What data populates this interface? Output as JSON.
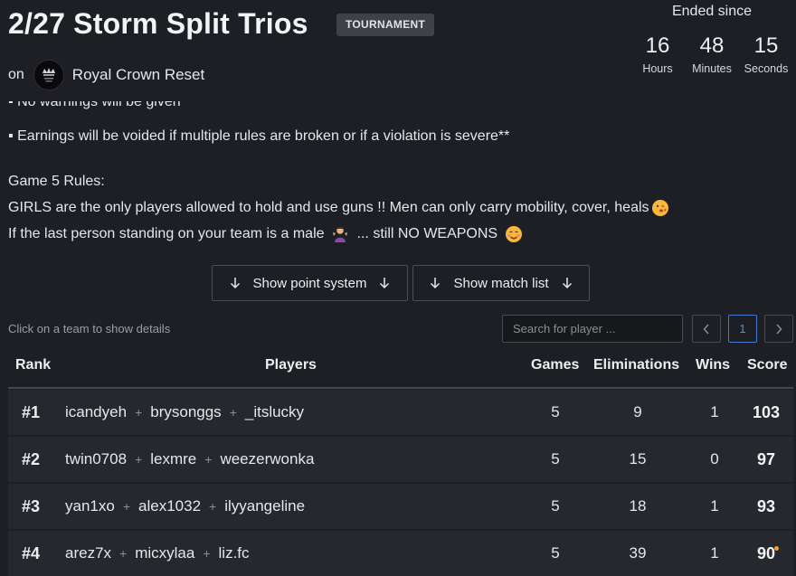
{
  "header": {
    "title": "2/27 Storm Split Trios",
    "badge": "TOURNAMENT",
    "on_label": "on",
    "org_name": "Royal Crown Reset"
  },
  "countdown": {
    "label": "Ended since",
    "hours": "16",
    "hours_label": "Hours",
    "minutes": "48",
    "minutes_label": "Minutes",
    "seconds": "15",
    "seconds_label": "Seconds"
  },
  "description": {
    "cut_line": "▪ No warnings will be given",
    "line1": "▪ Earnings will be voided if multiple rules are broken or if a violation is severe**",
    "line2": "Game 5 Rules:",
    "line3": "GIRLS are the only players allowed to hold and use guns !! Men can only carry mobility, cover, heals",
    "line4_a": "If the last person standing on your team is a male",
    "line4_b": "... still NO WEAPONS"
  },
  "buttons": {
    "point_system": "Show point system",
    "match_list": "Show match list"
  },
  "hint": "Click on a team to show details",
  "search": {
    "placeholder": "Search for player ..."
  },
  "pagination": {
    "current": "1"
  },
  "table": {
    "headers": {
      "rank": "Rank",
      "players": "Players",
      "games": "Games",
      "eliminations": "Eliminations",
      "wins": "Wins",
      "score": "Score"
    },
    "rows": [
      {
        "rank": "#1",
        "p1": "icandyeh",
        "p2": "brysonggs",
        "p3": "_itslucky",
        "games": "5",
        "elims": "9",
        "wins": "1",
        "score": "103"
      },
      {
        "rank": "#2",
        "p1": "twin0708",
        "p2": "lexmre",
        "p3": "weezerwonka",
        "games": "5",
        "elims": "15",
        "wins": "0",
        "score": "97"
      },
      {
        "rank": "#3",
        "p1": "yan1xo",
        "p2": "alex1032",
        "p3": "ilyyangeline",
        "games": "5",
        "elims": "18",
        "wins": "1",
        "score": "93"
      },
      {
        "rank": "#4",
        "p1": "arez7x",
        "p2": "micxylaa",
        "p3": "liz.fc",
        "games": "5",
        "elims": "39",
        "wins": "1",
        "score": "90"
      }
    ]
  },
  "colors": {
    "background": "#1d1f24",
    "row": "#26282d",
    "accent": "#3c7fd0",
    "dot": "#f0a030"
  }
}
